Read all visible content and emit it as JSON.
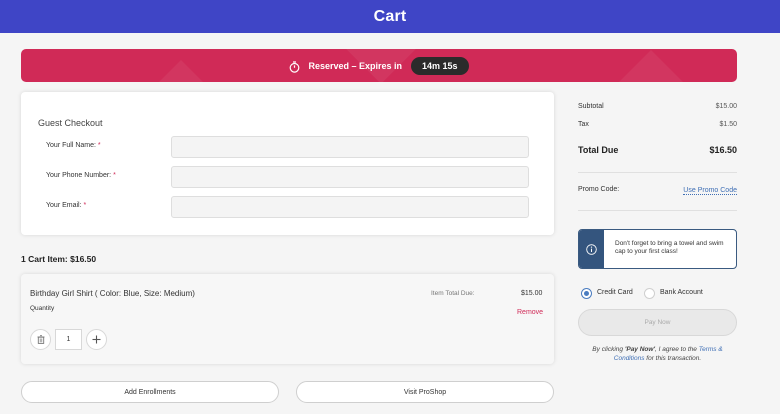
{
  "header": {
    "title": "Cart"
  },
  "banner": {
    "reserved_text": "Reserved – Expires in",
    "countdown": "14m 15s",
    "icon": "timer-icon"
  },
  "guest_checkout": {
    "title": "Guest Checkout",
    "fields": [
      {
        "label": "Your Full Name:",
        "required": "*",
        "value": "",
        "placeholder": ""
      },
      {
        "label": "Your Phone Number:",
        "required": "*",
        "value": "",
        "placeholder": ""
      },
      {
        "label": "Your Email:",
        "required": "*",
        "value": "",
        "placeholder": ""
      }
    ]
  },
  "cart": {
    "count_label": "1 Cart Item: $16.50",
    "items": [
      {
        "name": "Birthday Girl Shirt ( Color: Blue, Size: Medium)",
        "quantity_label": "Quantity",
        "quantity": "1",
        "total_label": "Item Total Due:",
        "total": "$15.00",
        "remove_label": "Remove"
      }
    ]
  },
  "actions": {
    "add_enrollments": "Add Enrollments",
    "visit_proshop": "Visit ProShop"
  },
  "summary": {
    "subtotal_label": "Subtotal",
    "subtotal": "$15.00",
    "tax_label": "Tax",
    "tax": "$1.50",
    "total_label": "Total Due",
    "total": "$16.50",
    "promo_label": "Promo Code:",
    "promo_link": "Use Promo Code"
  },
  "notice": {
    "text": "Don't forget to bring a towel and swim cap to your first class!",
    "icon": "info-icon"
  },
  "payment": {
    "methods": [
      {
        "label": "Credit Card",
        "selected": true
      },
      {
        "label": "Bank Account",
        "selected": false
      }
    ],
    "pay_label": "Pay Now"
  },
  "terms": {
    "prefix": "By clicking ",
    "quoted": "'Pay Now'",
    "middle": ", I agree to the ",
    "link": "Terms & Conditions",
    "suffix": " for this transaction."
  },
  "colors": {
    "header": "#3f45c6",
    "banner": "#d02a57",
    "link": "#3f6fb5",
    "notice": "#34557e",
    "radio": "#4a7cc0"
  }
}
